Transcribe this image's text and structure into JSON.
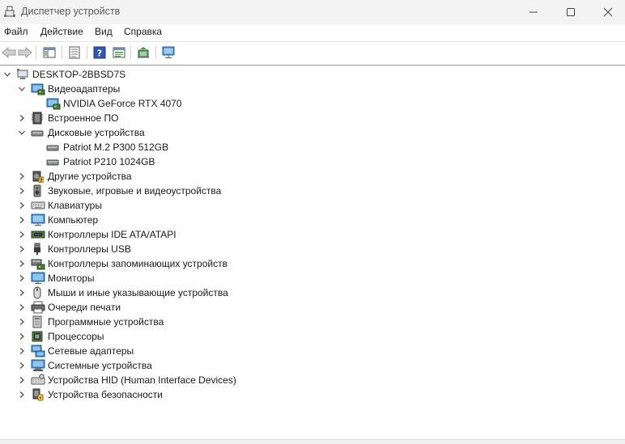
{
  "window": {
    "title": "Диспетчер устройств"
  },
  "menu": [
    "Файл",
    "Действие",
    "Вид",
    "Справка"
  ],
  "toolbar": {
    "buttons": [
      "back-icon",
      "forward-icon",
      "properties-view-icon",
      "document-icon",
      "help-icon",
      "view-icon",
      "update-driver-icon",
      "monitor-scan-icon"
    ]
  },
  "tree": {
    "root": "DESKTOP-2BBSD7S",
    "categories": [
      {
        "label": "Видеоадаптеры",
        "expanded": true,
        "icon": "display-adapter-icon",
        "children": [
          {
            "label": "NVIDIA GeForce RTX 4070",
            "icon": "display-adapter-icon"
          }
        ]
      },
      {
        "label": "Встроенное ПО",
        "expanded": false,
        "icon": "firmware-icon"
      },
      {
        "label": "Дисковые устройства",
        "expanded": true,
        "icon": "disk-drive-icon",
        "children": [
          {
            "label": "Patriot M.2 P300 512GB",
            "icon": "disk-drive-icon"
          },
          {
            "label": "Patriot P210 1024GB",
            "icon": "disk-drive-icon"
          }
        ]
      },
      {
        "label": "Другие устройства",
        "expanded": false,
        "icon": "unknown-device-icon"
      },
      {
        "label": "Звуковые, игровые и видеоустройства",
        "expanded": false,
        "icon": "speaker-icon"
      },
      {
        "label": "Клавиатуры",
        "expanded": false,
        "icon": "keyboard-icon"
      },
      {
        "label": "Компьютер",
        "expanded": false,
        "icon": "computer-icon"
      },
      {
        "label": "Контроллеры IDE ATA/ATAPI",
        "expanded": false,
        "icon": "ide-controller-icon"
      },
      {
        "label": "Контроллеры USB",
        "expanded": false,
        "icon": "usb-icon"
      },
      {
        "label": "Контроллеры запоминающих устройств",
        "expanded": false,
        "icon": "storage-controller-icon"
      },
      {
        "label": "Мониторы",
        "expanded": false,
        "icon": "monitor-icon"
      },
      {
        "label": "Мыши и иные указывающие устройства",
        "expanded": false,
        "icon": "mouse-icon"
      },
      {
        "label": "Очереди печати",
        "expanded": false,
        "icon": "printer-icon"
      },
      {
        "label": "Программные устройства",
        "expanded": false,
        "icon": "software-device-icon"
      },
      {
        "label": "Процессоры",
        "expanded": false,
        "icon": "processor-icon"
      },
      {
        "label": "Сетевые адаптеры",
        "expanded": false,
        "icon": "network-adapter-icon"
      },
      {
        "label": "Системные устройства",
        "expanded": false,
        "icon": "system-device-icon"
      },
      {
        "label": "Устройства HID (Human Interface Devices)",
        "expanded": false,
        "icon": "hid-icon"
      },
      {
        "label": "Устройства безопасности",
        "expanded": false,
        "icon": "security-device-icon"
      }
    ]
  }
}
